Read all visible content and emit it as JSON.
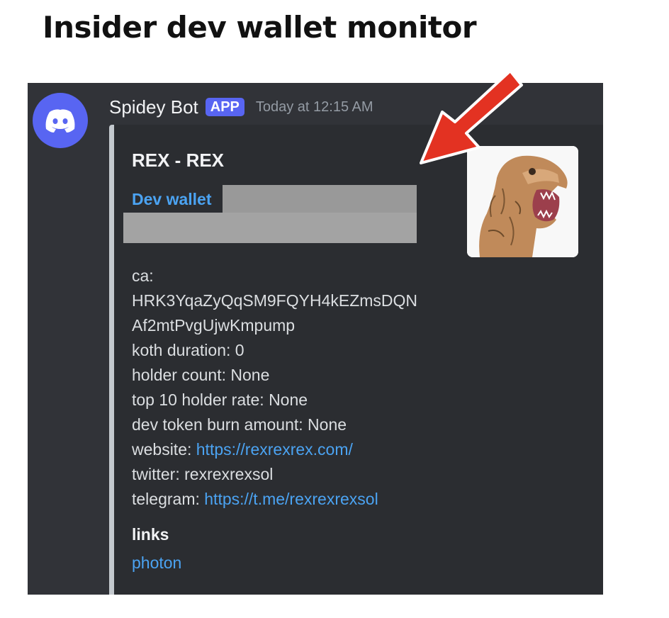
{
  "page_heading": "Insider dev wallet monitor",
  "message": {
    "username": "Spidey Bot",
    "badge": "APP",
    "timestamp": "Today at 12:15 AM"
  },
  "embed": {
    "title": "REX - REX",
    "dev_wallet_label": "Dev wallet",
    "ca_label": "ca:",
    "ca_line1": "HRK3YqaZyQqSM9FQYH4kEZmsDQN",
    "ca_line2": "Af2mtPvgUjwKmpump",
    "koth_duration": "koth duration: 0",
    "holder_count": "holder count: None",
    "top10_rate": "top 10 holder rate: None",
    "dev_burn": "dev token burn amount: None",
    "website_label": "website: ",
    "website_url": "https://rexrexrex.com/",
    "twitter": "twitter: rexrexrexsol",
    "telegram_label": "telegram: ",
    "telegram_url": "https://t.me/rexrexrexsol",
    "links_heading": "links",
    "photon_link": "photon"
  },
  "icons": {
    "avatar": "discord-logo-icon",
    "thumbnail": "trex-costume-image",
    "annotation": "red-arrow-icon"
  },
  "colors": {
    "discord_bg": "#313338",
    "embed_bg": "#2b2d31",
    "blurple": "#5865f2",
    "link": "#4ba3f2",
    "arrow": "#e33222"
  }
}
